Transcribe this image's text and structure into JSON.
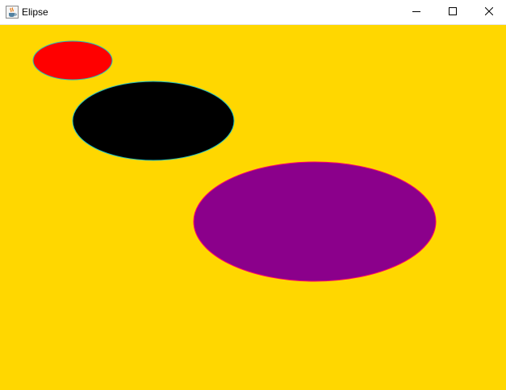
{
  "window": {
    "title": "Elipse",
    "icon": "java-cup-icon",
    "controls": {
      "minimize_icon": "minimize-icon",
      "maximize_icon": "maximize-icon",
      "close_icon": "close-icon"
    }
  },
  "canvas": {
    "background_color": "#ffd700",
    "ellipses": [
      {
        "name": "red-ellipse",
        "fill": "#ff0000",
        "stroke": "#20c0c0"
      },
      {
        "name": "black-ellipse",
        "fill": "#000000",
        "stroke": "#20c0c0"
      },
      {
        "name": "purple-ellipse",
        "fill": "#8b008b",
        "stroke": "#ff0066"
      }
    ]
  }
}
